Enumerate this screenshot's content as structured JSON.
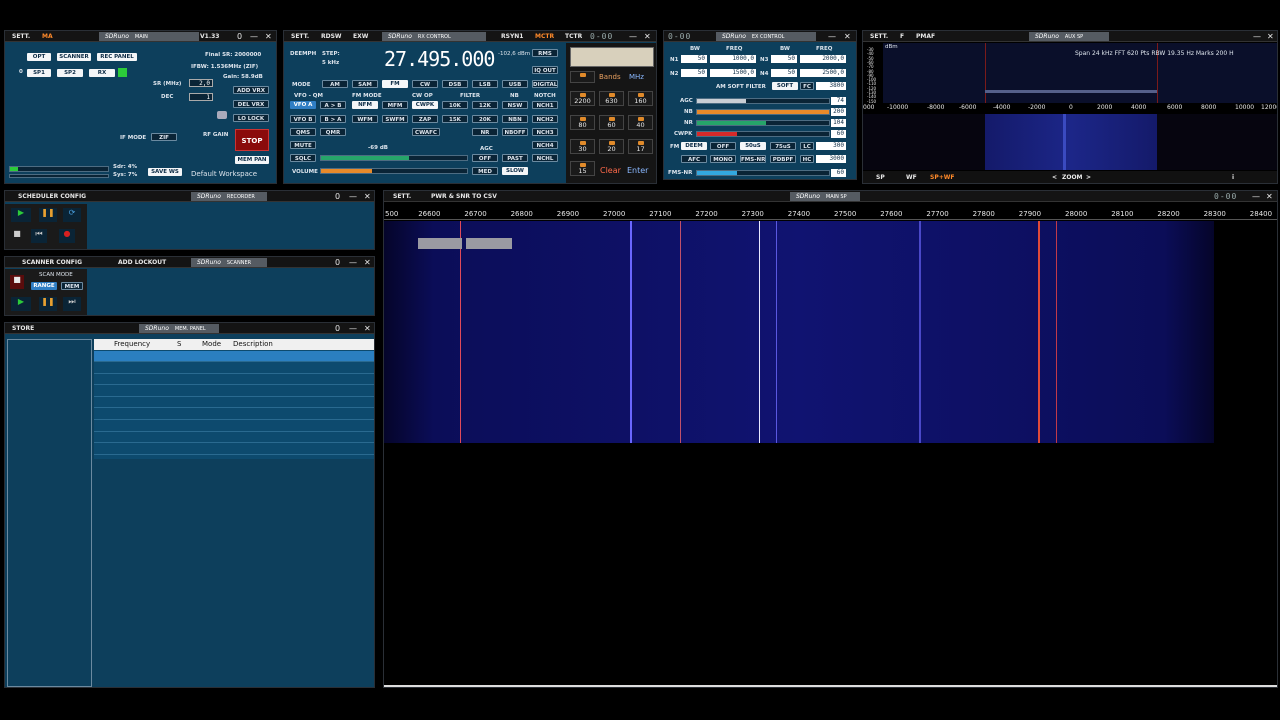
{
  "main": {
    "sett": "SETT.",
    "ma": "MA",
    "brand": "SDRuno",
    "brand_sub": "MAIN",
    "version": "V1.33",
    "buttons": [
      "OPT",
      "SCANNER",
      "REC PANEL",
      "SP1",
      "SP2",
      "RX"
    ],
    "row_index": "0",
    "final_sr": "Final SR: 2000000",
    "ifbw": "IFBW: 1.536MHz (ZIF)",
    "gain": "Gain: 58.9dB",
    "sr_label": "SR (MHz)",
    "sr_value": "2,0",
    "dec_label": "DEC",
    "dec_value": "1",
    "add_vrx": "ADD VRX",
    "del_vrx": "DEL VRX",
    "lo_lock": "LO LOCK",
    "if_mode": "IF MODE",
    "zif": "ZIF",
    "rf_gain": "RF GAIN",
    "stop": "STOP",
    "mem_pan": "MEM PAN",
    "sdr_load": "Sdr: 4%",
    "sys_load": "Sys: 7%",
    "save_ws": "SAVE WS",
    "workspace": "Default Workspace",
    "cpu_level": 0.08
  },
  "rx": {
    "sett": "SETT.",
    "rdsw": "RDSW",
    "exw": "EXW",
    "brand": "SDRuno",
    "brand_sub": "RX CONTROL",
    "rsyn1": "RSYN1",
    "mctr": "MCTR",
    "tctr": "TCTR",
    "deemph": "DEEMPH",
    "step": "STEP:",
    "step_val": "5 kHz",
    "frequency": "27.495.000",
    "dbm": "-102,6 dBm",
    "rms": "RMS",
    "iq_out": "IQ OUT",
    "digital": "DIGITAL",
    "mode_label": "MODE",
    "modes": [
      "AM",
      "SAM",
      "FM",
      "CW",
      "DSB",
      "LSB",
      "USB"
    ],
    "vfo_label": "VFO - QM",
    "fm_mode_label": "FM MODE",
    "cw_op_label": "CW OP",
    "filter_label": "FILTER",
    "nb_label": "NB",
    "notch_label": "NOTCH",
    "vfoa": "VFO A",
    "atob": "A > B",
    "nfm": "NFM",
    "mfm": "MFM",
    "cwpk": "CWPK",
    "f10k": "10K",
    "f12k": "12K",
    "nsw": "NSW",
    "nch1": "NCH1",
    "vfob": "VFO B",
    "btoa": "B > A",
    "wfm": "WFM",
    "swfm": "SWFM",
    "zap": "ZAP",
    "f15k": "15K",
    "f20k": "20K",
    "nbn": "NBN",
    "nch2": "NCH2",
    "qms": "QMS",
    "qmr": "QMR",
    "cwafc": "CWAFC",
    "nr": "NR",
    "nboff": "NBOFF",
    "nch3": "NCH3",
    "nch4": "NCH4",
    "mute": "MUTE",
    "sqlc": "SQLC",
    "volume": "VOLUME",
    "sq_db": "-69 dB",
    "agc_label": "AGC",
    "agc_off": "OFF",
    "agc_med": "MED",
    "past": "PAST",
    "slow": "SLOW",
    "nch": "NCHL",
    "sq_level": 0.6,
    "vol_level": 0.35,
    "bands": "Bands",
    "mhz": "MHz",
    "keys": [
      "2200",
      "630",
      "160",
      "80",
      "60",
      "40",
      "30",
      "20",
      "17",
      "15"
    ],
    "clear": "Clear",
    "enter": "Enter"
  },
  "ex": {
    "brand": "SDRuno",
    "brand_sub": "EX CONTROL",
    "bw": "BW",
    "freq": "FREQ",
    "n1": "N1",
    "n1_bw": "50",
    "n1_freq": "1000,0",
    "n2": "N2",
    "n2_bw": "50",
    "n2_freq": "1500,0",
    "n3": "N3",
    "n3_bw": "50",
    "n3_freq": "2000,0",
    "n4": "N4",
    "n4_bw": "50",
    "n4_freq": "2500,0",
    "am_soft": "AM SOFT FILTER",
    "soft": "SOFT",
    "fc": "FC",
    "fc_val": "3800",
    "agc": "AGC",
    "agc_val": "74",
    "nb": "NB",
    "nb_val": "200",
    "nr": "NR",
    "nr_val": "104",
    "cwpk": "CWPK",
    "cwpk_val": "60",
    "fm": "FM",
    "deem": "DEEM",
    "off": "OFF",
    "us50": "50uS",
    "us75": "75uS",
    "lc": "LC",
    "lc_val": "300",
    "afc": "AFC",
    "mono": "MONO",
    "fmsnr": "FMS-NR",
    "pdbpf": "PDBPF",
    "hc": "HC",
    "hc_val": "3000",
    "fmsnr2": "FMS-NR",
    "fmsnr_val": "60",
    "agc_level": 0.37,
    "nb_level": 1.0,
    "nr_level": 0.52,
    "cwpk_level": 0.3,
    "fmsnr_level": 0.3,
    "colors": {
      "agc": "#c9ced4",
      "nb": "#e88a2a",
      "nr": "#26a56a",
      "cwpk": "#d62a2a",
      "fmsnr": "#33a8e0"
    }
  },
  "aux": {
    "sett": "SETT.",
    "f": "F",
    "pmaf": "PMAF",
    "brand": "SDRuno",
    "brand_sub": "AUX SP",
    "info": "Span 24 kHz   FFT 620 Pts   RBW 19.35 Hz   Marks 200 H",
    "dbm": "dBm",
    "y_ticks": [
      "-30",
      "-40",
      "-50",
      "-60",
      "-70",
      "-80",
      "-90",
      "-100",
      "-110",
      "-120",
      "-130",
      "-140",
      "-150"
    ],
    "x_ticks": [
      "000",
      "-10000",
      "-8000",
      "-6000",
      "-4000",
      "-2000",
      "0",
      "2000",
      "4000",
      "6000",
      "8000",
      "10000",
      "12000"
    ],
    "sp": "SP",
    "wf": "WF",
    "spwf": "SP+WF",
    "zoom": "ZOOM",
    "zoom_l": "<",
    "zoom_r": ">",
    "info_icon": "i"
  },
  "scheduler": {
    "config": "SCHEDULER CONFIG",
    "brand": "SDRuno",
    "brand_sub": "RECORDER"
  },
  "scanner": {
    "config": "SCANNER CONFIG",
    "add_lockout": "ADD LOCKOUT",
    "brand": "SDRuno",
    "brand_sub": "SCANNER",
    "scan_mode": "SCAN MODE",
    "range": "RANGE",
    "mem": "MEM"
  },
  "mem": {
    "store": "STORE",
    "brand": "SDRuno",
    "brand_sub": "MEM. PANEL",
    "columns": [
      "Frequency",
      "S",
      "Mode",
      "Description"
    ]
  },
  "mainsp": {
    "sett": "SETT.",
    "pwr": "PWR & SNR TO CSV",
    "brand": "SDRuno",
    "brand_sub": "MAIN SP",
    "x_ticks": [
      "500",
      "26600",
      "26700",
      "26800",
      "26900",
      "27000",
      "27100",
      "27200",
      "27300",
      "27400",
      "27500",
      "27600",
      "27700",
      "27800",
      "27900",
      "28000",
      "28100",
      "28200",
      "28300",
      "28400"
    ]
  },
  "window": {
    "digits": "0-00",
    "minimize": "—",
    "close": "✕",
    "restore": "0"
  }
}
